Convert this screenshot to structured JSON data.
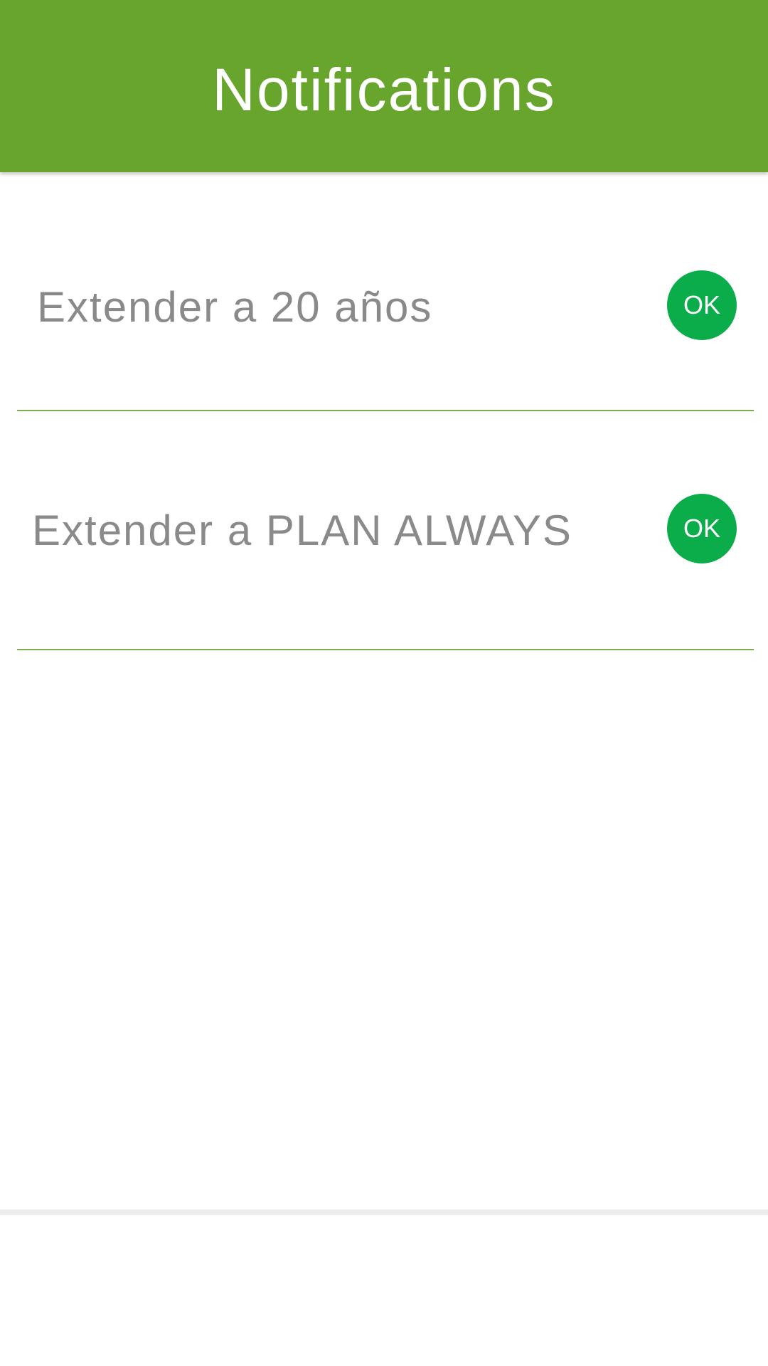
{
  "header": {
    "title": "Notifications",
    "color": "#68a52d"
  },
  "notifications": [
    {
      "label": "Extender a 20 años",
      "action_label": "OK"
    },
    {
      "label": "Extender a PLAN ALWAYS",
      "action_label": "OK"
    }
  ],
  "colors": {
    "ok_button": "#0bad4a",
    "divider": "#7dad4c",
    "text": "#8a8a8a"
  }
}
